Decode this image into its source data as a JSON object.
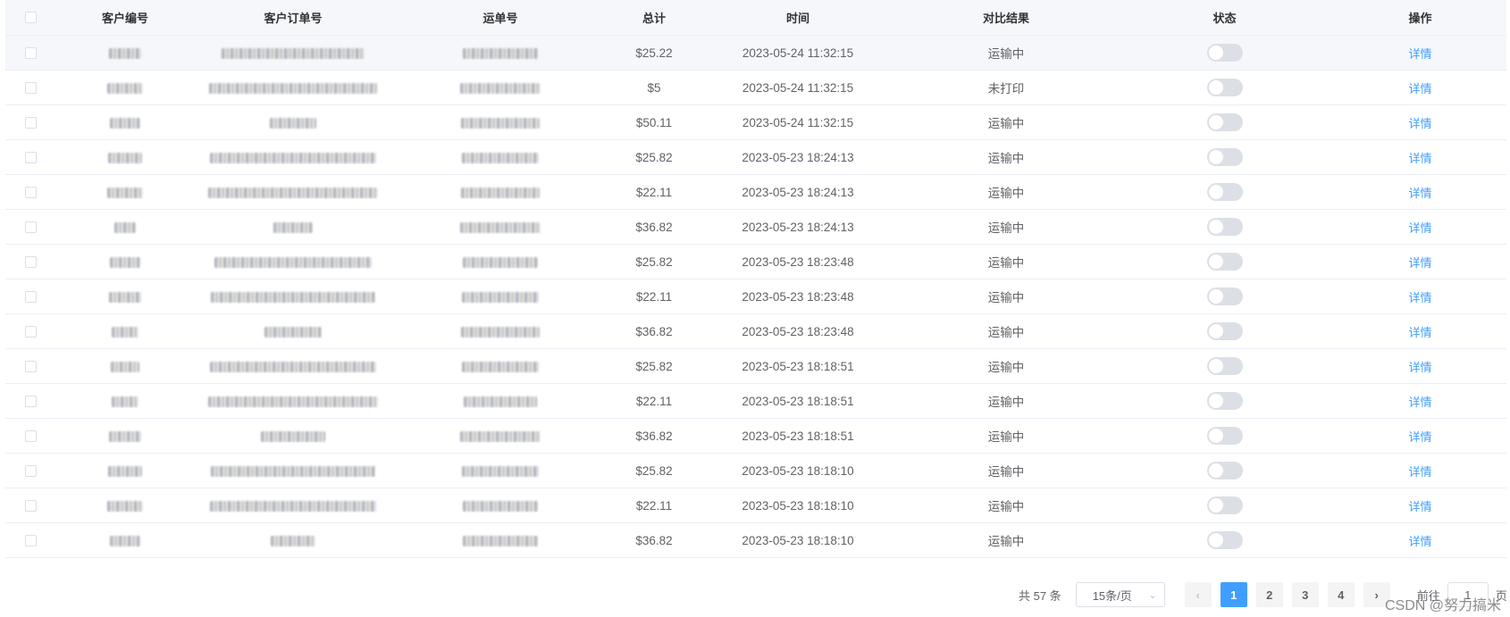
{
  "table": {
    "headers": {
      "customer_id": "客户编号",
      "customer_order": "客户订单号",
      "waybill": "运单号",
      "total": "总计",
      "time": "时间",
      "compare": "对比结果",
      "status": "状态",
      "action": "操作"
    },
    "rows": [
      {
        "total": "$25.22",
        "time": "2023-05-24 11:32:15",
        "compare": "运输中",
        "action": "详情"
      },
      {
        "total": "$5",
        "time": "2023-05-24 11:32:15",
        "compare": "未打印",
        "action": "详情"
      },
      {
        "total": "$50.11",
        "time": "2023-05-24 11:32:15",
        "compare": "运输中",
        "action": "详情"
      },
      {
        "total": "$25.82",
        "time": "2023-05-23 18:24:13",
        "compare": "运输中",
        "action": "详情"
      },
      {
        "total": "$22.11",
        "time": "2023-05-23 18:24:13",
        "compare": "运输中",
        "action": "详情"
      },
      {
        "total": "$36.82",
        "time": "2023-05-23 18:24:13",
        "compare": "运输中",
        "action": "详情"
      },
      {
        "total": "$25.82",
        "time": "2023-05-23 18:23:48",
        "compare": "运输中",
        "action": "详情"
      },
      {
        "total": "$22.11",
        "time": "2023-05-23 18:23:48",
        "compare": "运输中",
        "action": "详情"
      },
      {
        "total": "$36.82",
        "time": "2023-05-23 18:23:48",
        "compare": "运输中",
        "action": "详情"
      },
      {
        "total": "$25.82",
        "time": "2023-05-23 18:18:51",
        "compare": "运输中",
        "action": "详情"
      },
      {
        "total": "$22.11",
        "time": "2023-05-23 18:18:51",
        "compare": "运输中",
        "action": "详情"
      },
      {
        "total": "$36.82",
        "time": "2023-05-23 18:18:51",
        "compare": "运输中",
        "action": "详情"
      },
      {
        "total": "$25.82",
        "time": "2023-05-23 18:18:10",
        "compare": "运输中",
        "action": "详情"
      },
      {
        "total": "$22.11",
        "time": "2023-05-23 18:18:10",
        "compare": "运输中",
        "action": "详情"
      },
      {
        "total": "$36.82",
        "time": "2023-05-23 18:18:10",
        "compare": "运输中",
        "action": "详情"
      }
    ]
  },
  "pagination": {
    "total_text": "共 57 条",
    "page_size": "15条/页",
    "pages": [
      "1",
      "2",
      "3",
      "4"
    ],
    "current_page": "1",
    "prev": "‹",
    "next": "›",
    "goto_label": "前往",
    "goto_value": "1",
    "goto_suffix": "页"
  },
  "watermark": "CSDN @努力搞米",
  "colors": {
    "accent": "#409eff",
    "header_bg": "#f5f7fa",
    "switch_off": "#dcdfe6"
  }
}
